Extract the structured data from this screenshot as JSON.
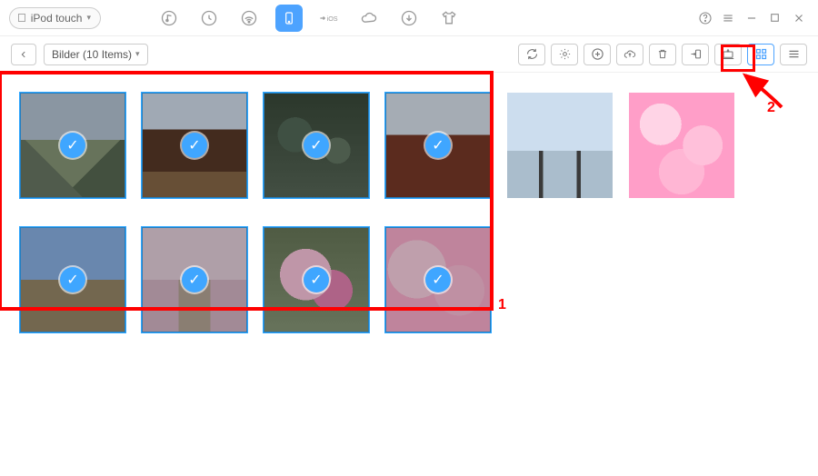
{
  "device": {
    "label": "iPod touch"
  },
  "breadcrumb": {
    "label": "Bilder (10 Items)"
  },
  "callouts": {
    "one": "1",
    "two": "2"
  },
  "thumbs": [
    {
      "name": "castle",
      "bg": "bg-castle",
      "selected": true
    },
    {
      "name": "temple1",
      "bg": "bg-temple1",
      "selected": true
    },
    {
      "name": "lantern",
      "bg": "bg-lantern",
      "selected": true
    },
    {
      "name": "temple2",
      "bg": "bg-temple2",
      "selected": true
    },
    {
      "name": "torii",
      "bg": "bg-torii",
      "selected": false
    },
    {
      "name": "sakura",
      "bg": "bg-sakura",
      "selected": false
    },
    {
      "name": "trees",
      "bg": "bg-trees",
      "selected": true
    },
    {
      "name": "path",
      "bg": "bg-path",
      "selected": true
    },
    {
      "name": "macro",
      "bg": "bg-macro",
      "selected": true
    },
    {
      "name": "blur",
      "bg": "bg-blur",
      "selected": true
    }
  ]
}
